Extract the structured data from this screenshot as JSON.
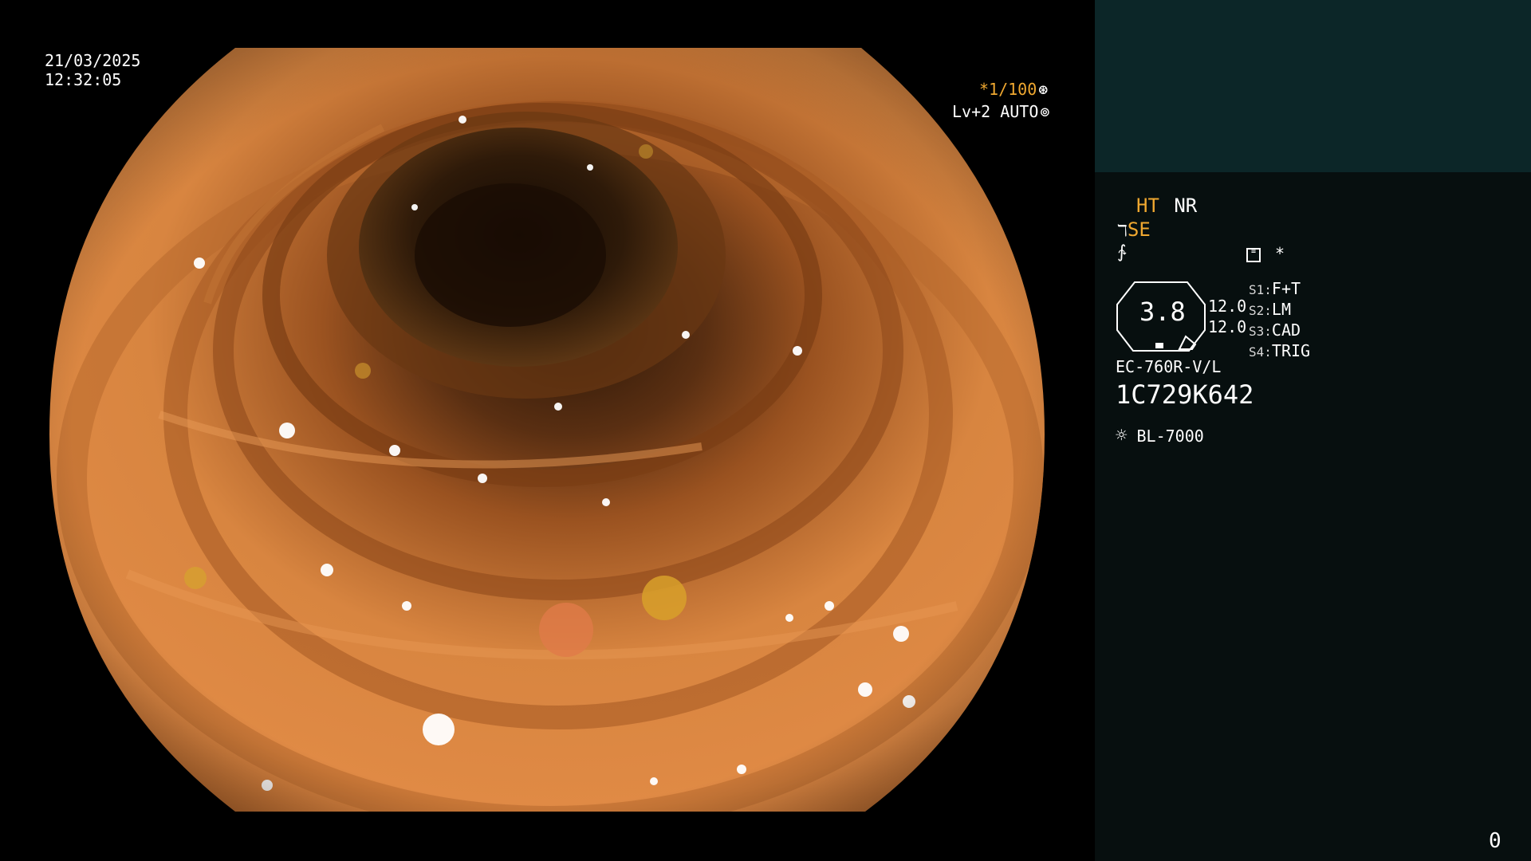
{
  "overlay": {
    "date": "21/03/2025",
    "time": "12:32:05",
    "shutter": "*1/100",
    "shutter_icon": "aperture-icon",
    "level": "Lv+2 AUTO",
    "level_icon": "iris-icon"
  },
  "panel": {
    "ht_label": "HT",
    "nr_label": "NR",
    "se_label": "SE",
    "asterisk": "*",
    "zoom_value": "3.8",
    "value_a": "12.0",
    "value_b": "12.0",
    "presets": [
      {
        "key": "S1:",
        "value": "F+T"
      },
      {
        "key": "S2:",
        "value": "LM"
      },
      {
        "key": "S3:",
        "value": "CAD"
      },
      {
        "key": "S4:",
        "value": "TRIG"
      }
    ],
    "scope_model": "EC-760R-V/L",
    "serial": "1C729K642",
    "light_source": "BL-7000",
    "counter": "0"
  },
  "colors": {
    "accent_orange": "#f0a830",
    "panel_top": "#0c2628",
    "panel_bg": "#070f0f"
  }
}
